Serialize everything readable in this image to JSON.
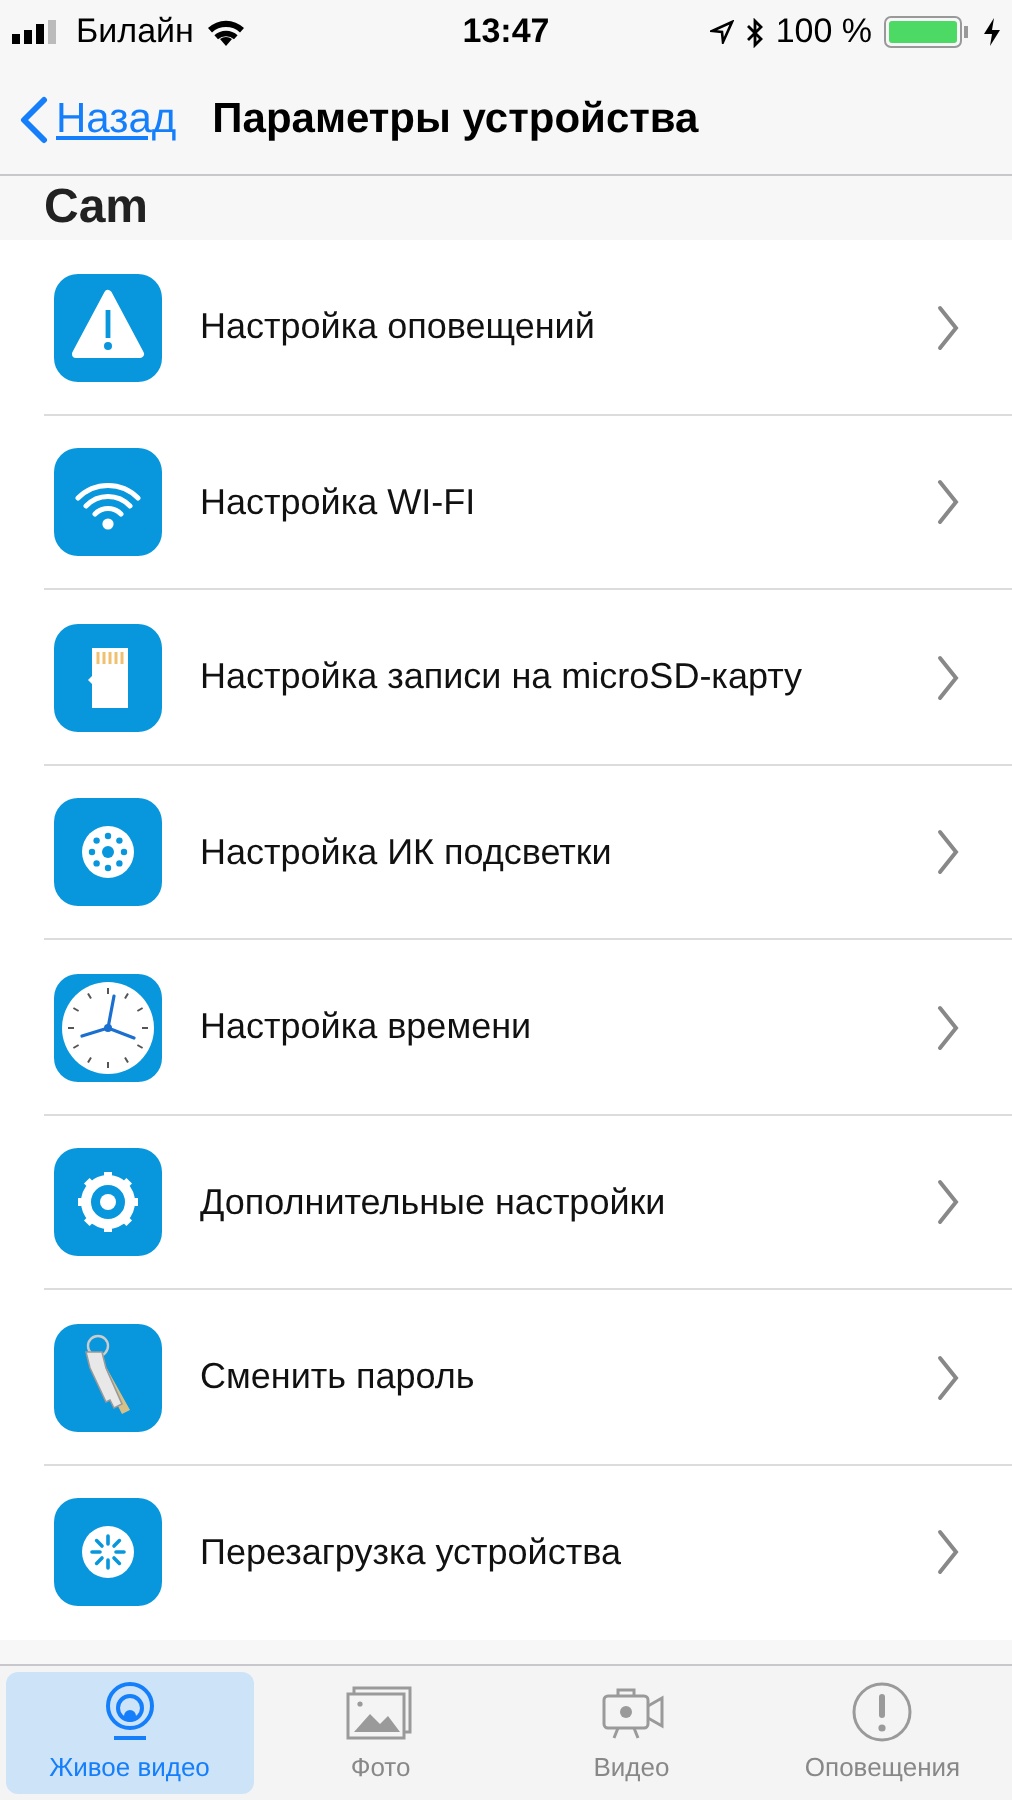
{
  "status_bar": {
    "carrier": "Билайн",
    "time": "13:47",
    "battery": "100 %"
  },
  "nav_bar": {
    "back": "Назад",
    "title": "Параметры устройства"
  },
  "section": {
    "title": "Cam"
  },
  "items": [
    {
      "label": "Настройка оповещений"
    },
    {
      "label": "Настройка WI-FI"
    },
    {
      "label": "Настройка записи на microSD-карту"
    },
    {
      "label": "Настройка ИК подсветки"
    },
    {
      "label": "Настройка времени"
    },
    {
      "label": "Дополнительные настройки"
    },
    {
      "label": "Сменить пароль"
    },
    {
      "label": "Перезагрузка устройства"
    }
  ],
  "tabs": [
    {
      "label": "Живое видео",
      "selected": true
    },
    {
      "label": "Фото",
      "selected": false
    },
    {
      "label": "Видео",
      "selected": false
    },
    {
      "label": "Оповещения",
      "selected": false
    }
  ]
}
